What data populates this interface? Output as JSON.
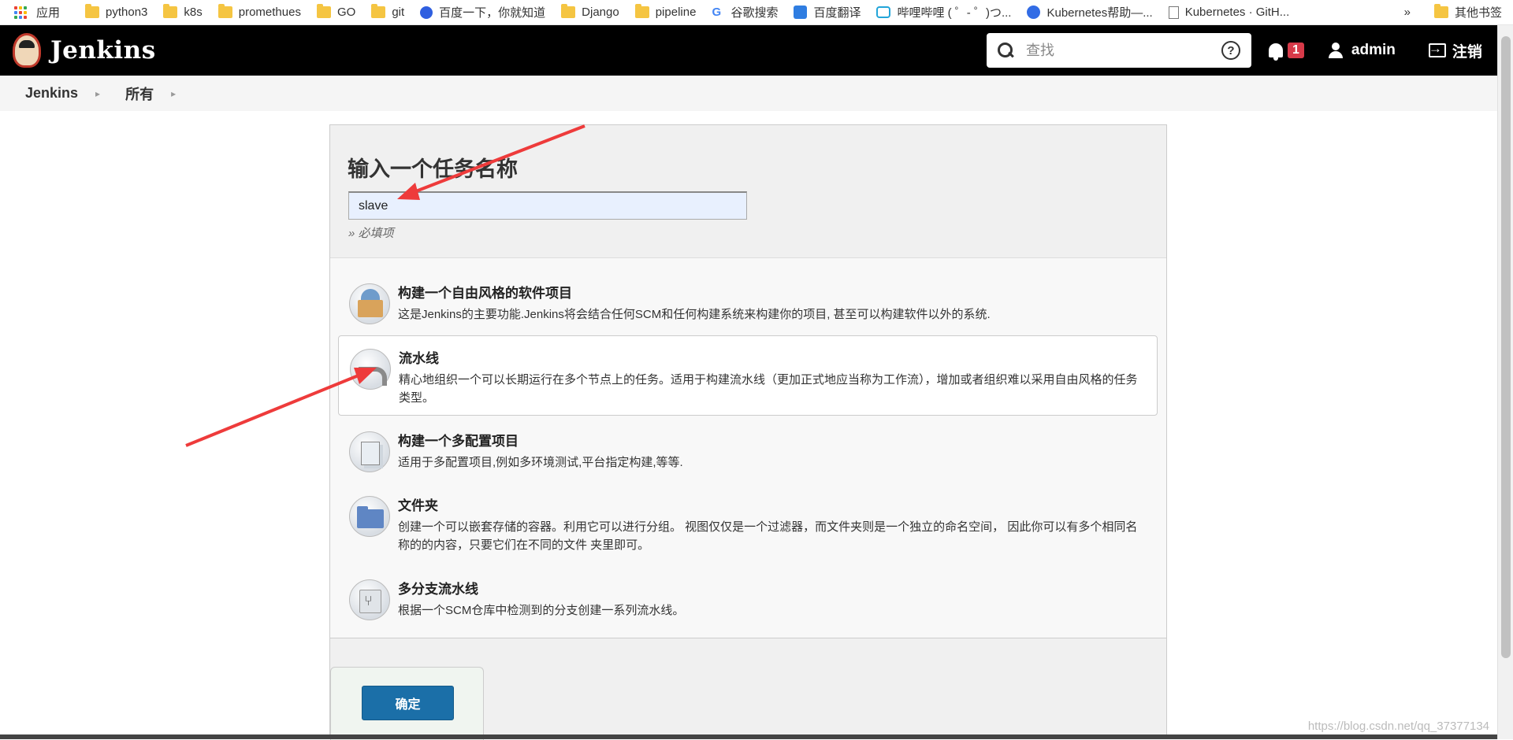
{
  "bookmarks": {
    "items": [
      {
        "label": "应用",
        "icon": "apps-icon"
      },
      {
        "label": "python3",
        "icon": "folder-icon"
      },
      {
        "label": "k8s",
        "icon": "folder-icon"
      },
      {
        "label": "promethues",
        "icon": "folder-icon"
      },
      {
        "label": "GO",
        "icon": "folder-icon"
      },
      {
        "label": "git",
        "icon": "folder-icon"
      },
      {
        "label": "百度一下，你就知道",
        "icon": "baidu-icon"
      },
      {
        "label": "Django",
        "icon": "folder-icon"
      },
      {
        "label": "pipeline",
        "icon": "folder-icon"
      },
      {
        "label": "谷歌搜索",
        "icon": "google-icon"
      },
      {
        "label": "百度翻译",
        "icon": "translate-icon"
      },
      {
        "label": "哔哩哔哩 ( ゜- ゜)つ...",
        "icon": "bilibili-icon"
      },
      {
        "label": "Kubernetes帮助—...",
        "icon": "kubernetes-icon"
      },
      {
        "label": "Kubernetes · GitH...",
        "icon": "page-icon"
      }
    ],
    "more": "»",
    "other": "其他书签"
  },
  "header": {
    "app_name": "Jenkins",
    "search_placeholder": "查找",
    "help": "?",
    "notification_count": "1",
    "user": "admin",
    "logout": "注销"
  },
  "breadcrumb": {
    "items": [
      "Jenkins",
      "所有"
    ]
  },
  "form": {
    "title": "输入一个任务名称",
    "name_value": "slave",
    "required_hint": "» 必填项",
    "items": [
      {
        "label": "构建一个自由风格的软件项目",
        "desc": "这是Jenkins的主要功能.Jenkins将会结合任何SCM和任何构建系统来构建你的项目, 甚至可以构建软件以外的系统."
      },
      {
        "label": "流水线",
        "desc": "精心地组织一个可以长期运行在多个节点上的任务。适用于构建流水线（更加正式地应当称为工作流），增加或者组织难以采用自由风格的任务类型。"
      },
      {
        "label": "构建一个多配置项目",
        "desc": "适用于多配置项目,例如多环境测试,平台指定构建,等等."
      },
      {
        "label": "文件夹",
        "desc": "创建一个可以嵌套存储的容器。利用它可以进行分组。 视图仅仅是一个过滤器，而文件夹则是一个独立的命名空间， 因此你可以有多个相同名称的的内容，只要它们在不同的文件 夹里即可。"
      },
      {
        "label": "多分支流水线",
        "desc": "根据一个SCM仓库中检测到的分支创建一系列流水线。"
      }
    ],
    "ok_button": "确定"
  },
  "watermark": "https://blog.csdn.net/qq_37377134",
  "colors": {
    "header_bg": "#000000",
    "ok_button": "#1b6fa8",
    "badge": "#d73a49",
    "arrow": "#ee3b3b"
  }
}
